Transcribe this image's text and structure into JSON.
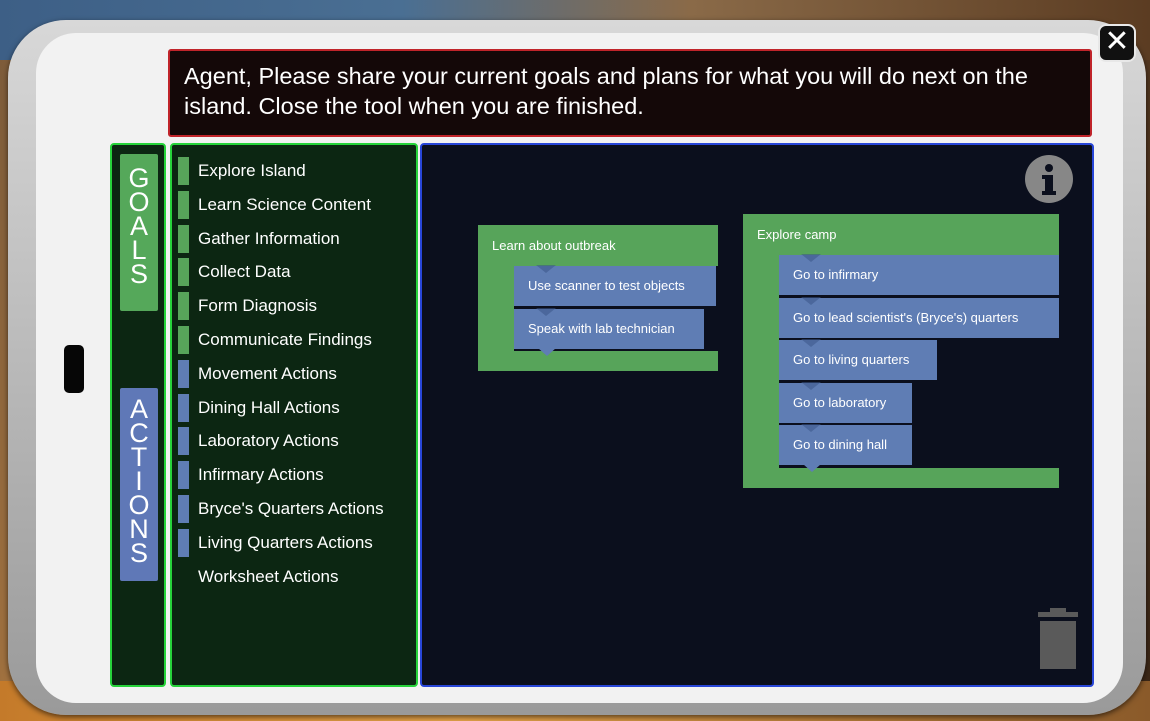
{
  "prompt": {
    "text": "Agent, Please share your current goals and plans for what you will do next on the island. Close the tool when you are finished."
  },
  "close_button": {
    "icon": "close-icon"
  },
  "tabs": {
    "goals": [
      "G",
      "O",
      "A",
      "L",
      "S"
    ],
    "actions": [
      "A",
      "C",
      "T",
      "I",
      "O",
      "N",
      "S"
    ]
  },
  "list": [
    {
      "label": "Explore Island",
      "kind": "goal"
    },
    {
      "label": "Learn Science Content",
      "kind": "goal"
    },
    {
      "label": "Gather Information",
      "kind": "goal"
    },
    {
      "label": "Collect Data",
      "kind": "goal"
    },
    {
      "label": "Form Diagnosis",
      "kind": "goal"
    },
    {
      "label": "Communicate Findings",
      "kind": "goal"
    },
    {
      "label": "Movement Actions",
      "kind": "action"
    },
    {
      "label": "Dining Hall Actions",
      "kind": "action"
    },
    {
      "label": "Laboratory Actions",
      "kind": "action"
    },
    {
      "label": "Infirmary Actions",
      "kind": "action"
    },
    {
      "label": "Bryce's Quarters Actions",
      "kind": "action"
    },
    {
      "label": "Living Quarters Actions",
      "kind": "action"
    },
    {
      "label": "Worksheet Actions",
      "kind": "none"
    }
  ],
  "plan_blocks": [
    {
      "goal": "Learn about outbreak",
      "actions": [
        "Use scanner to test objects",
        "Speak with lab technician"
      ]
    },
    {
      "goal": "Explore camp",
      "actions": [
        "Go to infirmary",
        "Go to lead scientist's (Bryce's) quarters",
        "Go to living quarters",
        "Go to laboratory",
        "Go to dining hall"
      ]
    }
  ],
  "colors": {
    "goal_green": "#57a45a",
    "action_blue": "#5f7db4",
    "panel_border_green": "#26d33a",
    "workspace_border_blue": "#2846d8",
    "prompt_border_red": "#c0242a"
  },
  "icons": {
    "info": "info-icon",
    "trash": "trash-icon"
  }
}
